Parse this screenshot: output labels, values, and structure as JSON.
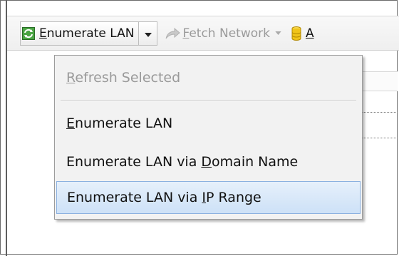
{
  "toolbar": {
    "enumerate_button": {
      "accel": "E",
      "rest": "numerate LAN",
      "icon": "refresh-green-icon"
    },
    "fetch_button": {
      "accel": "F",
      "rest": "etch Network",
      "icon": "arrow-forward-icon",
      "enabled": false
    },
    "next_label_accel": "A",
    "db_icon": "database-yellow-icon"
  },
  "menu": {
    "items": [
      {
        "pre": "",
        "accel": "R",
        "post": "efresh Selected",
        "enabled": false
      },
      {
        "pre": "",
        "accel": "E",
        "post": "numerate LAN",
        "enabled": true
      },
      {
        "pre": "Enumerate LAN via ",
        "accel": "D",
        "post": "omain Name",
        "enabled": true
      },
      {
        "pre": "Enumerate LAN via ",
        "accel": "I",
        "post": "P Range",
        "enabled": true,
        "selected": true
      }
    ]
  },
  "colors": {
    "selection_fill": "#cde1f7",
    "selection_border": "#8bb1e0",
    "icon_green": "#3a9a35",
    "db_yellow": "#f0c419"
  }
}
